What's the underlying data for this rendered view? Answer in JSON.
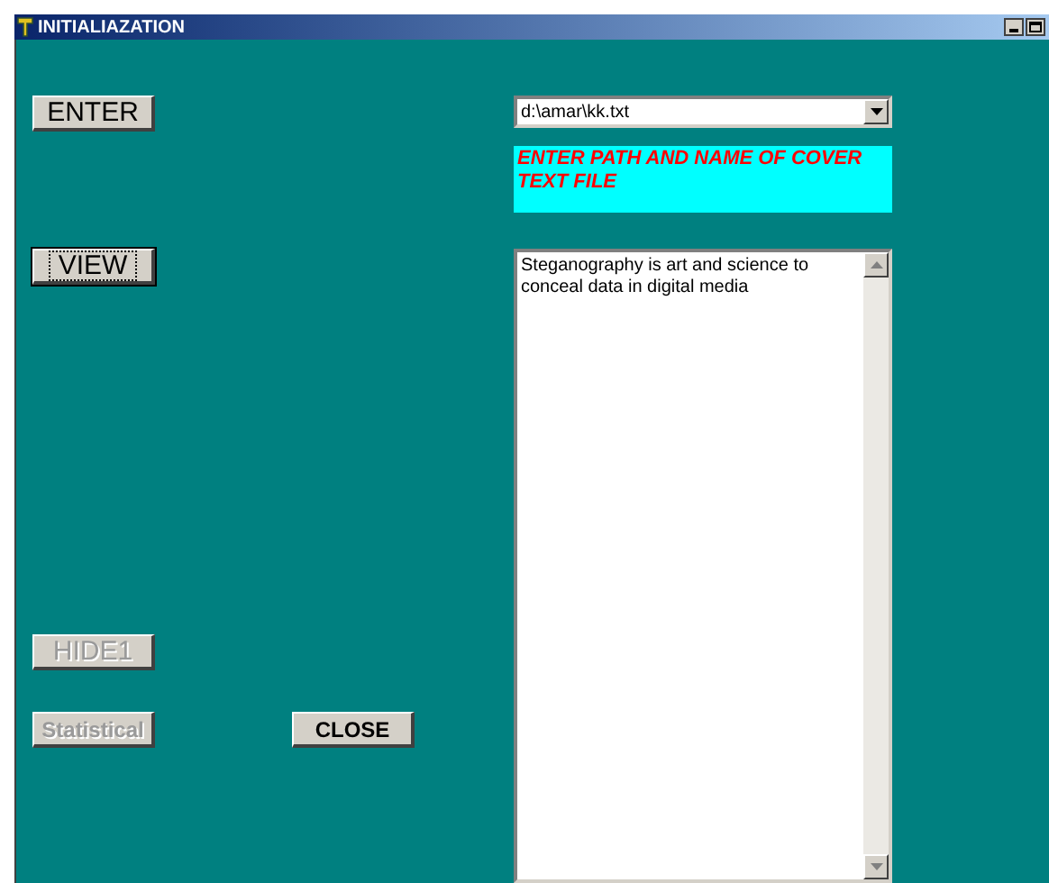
{
  "window": {
    "title": "INITIALIAZATION"
  },
  "buttons": [
    {
      "label": "ENTER",
      "disabled": false,
      "focused": false
    },
    {
      "label": "VIEW",
      "disabled": false,
      "focused": true
    },
    {
      "label": "HIDE1",
      "disabled": true,
      "focused": false
    },
    {
      "label": "Statistical",
      "disabled": true,
      "focused": false
    },
    {
      "label": "CLOSE",
      "disabled": false,
      "focused": false
    }
  ],
  "path_combo": {
    "value": "d:\\amar\\kk.txt"
  },
  "hint": "ENTER PATH AND NAME OF COVER TEXT FILE",
  "text_area": {
    "value": "Steganography is art and science to conceal data in digital media"
  }
}
